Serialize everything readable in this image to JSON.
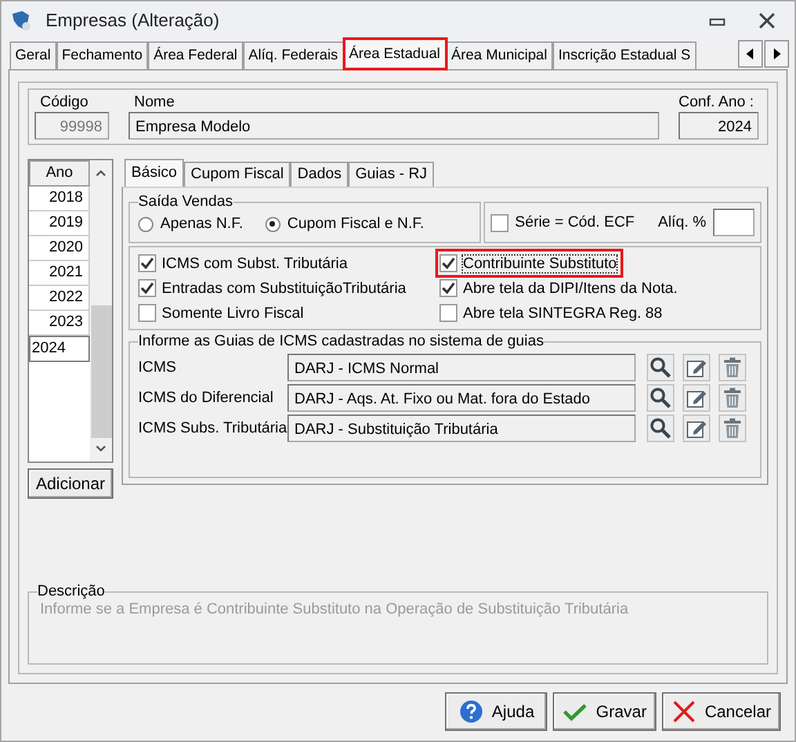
{
  "window": {
    "title": "Empresas (Alteração)"
  },
  "tabs": [
    {
      "label": "Geral",
      "selected": false,
      "highlighted": false
    },
    {
      "label": "Fechamento",
      "selected": false,
      "highlighted": false
    },
    {
      "label": "Área Federal",
      "selected": false,
      "highlighted": false
    },
    {
      "label": "Alíq. Federais",
      "selected": false,
      "highlighted": false
    },
    {
      "label": "Área Estadual",
      "selected": true,
      "highlighted": true
    },
    {
      "label": "Área Municipal",
      "selected": false,
      "highlighted": false
    },
    {
      "label": "Inscrição Estadual S",
      "selected": false,
      "highlighted": false
    }
  ],
  "header": {
    "code": {
      "label": "Código",
      "value": "99998",
      "disabled": true
    },
    "name": {
      "label": "Nome",
      "value": "Empresa Modelo"
    },
    "year": {
      "label": "Conf. Ano :",
      "value": "2024"
    }
  },
  "years": {
    "header": "Ano",
    "items": [
      {
        "label": "2018",
        "selected": false
      },
      {
        "label": "2019",
        "selected": false
      },
      {
        "label": "2020",
        "selected": false
      },
      {
        "label": "2021",
        "selected": false
      },
      {
        "label": "2022",
        "selected": false
      },
      {
        "label": "2023",
        "selected": false
      },
      {
        "label": "2024",
        "selected": true
      }
    ],
    "add_button": "Adicionar"
  },
  "inner_tabs": [
    {
      "label": "Básico",
      "selected": true
    },
    {
      "label": "Cupom Fiscal",
      "selected": false
    },
    {
      "label": "Dados",
      "selected": false
    },
    {
      "label": "Guias - RJ",
      "selected": false
    }
  ],
  "saida_vendas": {
    "title": "Saída Vendas",
    "options": [
      {
        "label": "Apenas N.F.",
        "selected": false
      },
      {
        "label": "Cupom Fiscal e N.F.",
        "selected": true
      }
    ]
  },
  "serie": {
    "label": "Série = Cód. ECF",
    "checked": false
  },
  "aliquota": {
    "label": "Alíq. %"
  },
  "checkboxes": [
    {
      "label": "ICMS com Subst. Tributária",
      "checked": true,
      "highlighted": false
    },
    {
      "label": "Contribuinte Substituto",
      "checked": true,
      "highlighted": true
    },
    {
      "label": "Entradas com SubstituiçãoTributária",
      "checked": true,
      "highlighted": false
    },
    {
      "label": "Abre tela da DIPI/Itens da Nota.",
      "checked": true,
      "highlighted": false
    },
    {
      "label": "Somente Livro Fiscal",
      "checked": false,
      "highlighted": false
    },
    {
      "label": "Abre tela SINTEGRA Reg. 88",
      "checked": false,
      "highlighted": false
    }
  ],
  "guias": {
    "title": "Informe as Guias de ICMS cadastradas no sistema de guias",
    "rows": [
      {
        "label": "ICMS",
        "value": "DARJ - ICMS Normal"
      },
      {
        "label": "ICMS do Diferencial",
        "value": "DARJ - Aqs. At. Fixo ou Mat. fora do Estado"
      },
      {
        "label": "ICMS Subs. Tributária",
        "value": "DARJ - Substituição Tributária"
      }
    ]
  },
  "descricao": {
    "title": "Descrição",
    "text": "Informe se a Empresa é Contribuinte Substituto na Operação de Substituição Tributária"
  },
  "buttons": [
    {
      "label": "Ajuda",
      "kind": "help"
    },
    {
      "label": "Gravar",
      "kind": "save"
    },
    {
      "label": "Cancelar",
      "kind": "cancel"
    }
  ]
}
